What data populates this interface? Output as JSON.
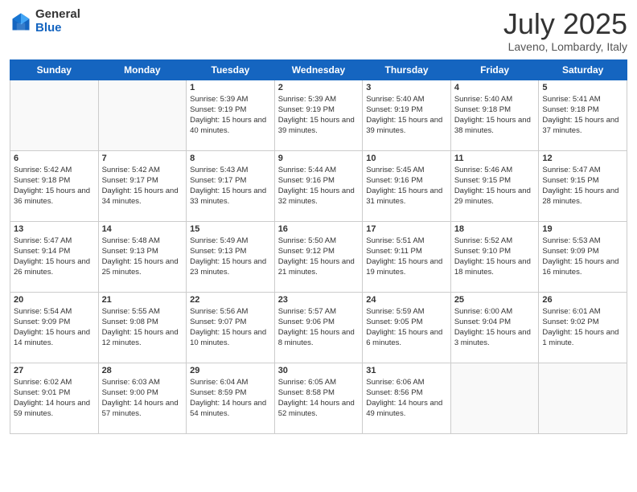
{
  "header": {
    "logo_general": "General",
    "logo_blue": "Blue",
    "month_title": "July 2025",
    "location": "Laveno, Lombardy, Italy"
  },
  "weekdays": [
    "Sunday",
    "Monday",
    "Tuesday",
    "Wednesday",
    "Thursday",
    "Friday",
    "Saturday"
  ],
  "weeks": [
    [
      {
        "day": "",
        "sunrise": "",
        "sunset": "",
        "daylight": ""
      },
      {
        "day": "",
        "sunrise": "",
        "sunset": "",
        "daylight": ""
      },
      {
        "day": "1",
        "sunrise": "Sunrise: 5:39 AM",
        "sunset": "Sunset: 9:19 PM",
        "daylight": "Daylight: 15 hours and 40 minutes."
      },
      {
        "day": "2",
        "sunrise": "Sunrise: 5:39 AM",
        "sunset": "Sunset: 9:19 PM",
        "daylight": "Daylight: 15 hours and 39 minutes."
      },
      {
        "day": "3",
        "sunrise": "Sunrise: 5:40 AM",
        "sunset": "Sunset: 9:19 PM",
        "daylight": "Daylight: 15 hours and 39 minutes."
      },
      {
        "day": "4",
        "sunrise": "Sunrise: 5:40 AM",
        "sunset": "Sunset: 9:18 PM",
        "daylight": "Daylight: 15 hours and 38 minutes."
      },
      {
        "day": "5",
        "sunrise": "Sunrise: 5:41 AM",
        "sunset": "Sunset: 9:18 PM",
        "daylight": "Daylight: 15 hours and 37 minutes."
      }
    ],
    [
      {
        "day": "6",
        "sunrise": "Sunrise: 5:42 AM",
        "sunset": "Sunset: 9:18 PM",
        "daylight": "Daylight: 15 hours and 36 minutes."
      },
      {
        "day": "7",
        "sunrise": "Sunrise: 5:42 AM",
        "sunset": "Sunset: 9:17 PM",
        "daylight": "Daylight: 15 hours and 34 minutes."
      },
      {
        "day": "8",
        "sunrise": "Sunrise: 5:43 AM",
        "sunset": "Sunset: 9:17 PM",
        "daylight": "Daylight: 15 hours and 33 minutes."
      },
      {
        "day": "9",
        "sunrise": "Sunrise: 5:44 AM",
        "sunset": "Sunset: 9:16 PM",
        "daylight": "Daylight: 15 hours and 32 minutes."
      },
      {
        "day": "10",
        "sunrise": "Sunrise: 5:45 AM",
        "sunset": "Sunset: 9:16 PM",
        "daylight": "Daylight: 15 hours and 31 minutes."
      },
      {
        "day": "11",
        "sunrise": "Sunrise: 5:46 AM",
        "sunset": "Sunset: 9:15 PM",
        "daylight": "Daylight: 15 hours and 29 minutes."
      },
      {
        "day": "12",
        "sunrise": "Sunrise: 5:47 AM",
        "sunset": "Sunset: 9:15 PM",
        "daylight": "Daylight: 15 hours and 28 minutes."
      }
    ],
    [
      {
        "day": "13",
        "sunrise": "Sunrise: 5:47 AM",
        "sunset": "Sunset: 9:14 PM",
        "daylight": "Daylight: 15 hours and 26 minutes."
      },
      {
        "day": "14",
        "sunrise": "Sunrise: 5:48 AM",
        "sunset": "Sunset: 9:13 PM",
        "daylight": "Daylight: 15 hours and 25 minutes."
      },
      {
        "day": "15",
        "sunrise": "Sunrise: 5:49 AM",
        "sunset": "Sunset: 9:13 PM",
        "daylight": "Daylight: 15 hours and 23 minutes."
      },
      {
        "day": "16",
        "sunrise": "Sunrise: 5:50 AM",
        "sunset": "Sunset: 9:12 PM",
        "daylight": "Daylight: 15 hours and 21 minutes."
      },
      {
        "day": "17",
        "sunrise": "Sunrise: 5:51 AM",
        "sunset": "Sunset: 9:11 PM",
        "daylight": "Daylight: 15 hours and 19 minutes."
      },
      {
        "day": "18",
        "sunrise": "Sunrise: 5:52 AM",
        "sunset": "Sunset: 9:10 PM",
        "daylight": "Daylight: 15 hours and 18 minutes."
      },
      {
        "day": "19",
        "sunrise": "Sunrise: 5:53 AM",
        "sunset": "Sunset: 9:09 PM",
        "daylight": "Daylight: 15 hours and 16 minutes."
      }
    ],
    [
      {
        "day": "20",
        "sunrise": "Sunrise: 5:54 AM",
        "sunset": "Sunset: 9:09 PM",
        "daylight": "Daylight: 15 hours and 14 minutes."
      },
      {
        "day": "21",
        "sunrise": "Sunrise: 5:55 AM",
        "sunset": "Sunset: 9:08 PM",
        "daylight": "Daylight: 15 hours and 12 minutes."
      },
      {
        "day": "22",
        "sunrise": "Sunrise: 5:56 AM",
        "sunset": "Sunset: 9:07 PM",
        "daylight": "Daylight: 15 hours and 10 minutes."
      },
      {
        "day": "23",
        "sunrise": "Sunrise: 5:57 AM",
        "sunset": "Sunset: 9:06 PM",
        "daylight": "Daylight: 15 hours and 8 minutes."
      },
      {
        "day": "24",
        "sunrise": "Sunrise: 5:59 AM",
        "sunset": "Sunset: 9:05 PM",
        "daylight": "Daylight: 15 hours and 6 minutes."
      },
      {
        "day": "25",
        "sunrise": "Sunrise: 6:00 AM",
        "sunset": "Sunset: 9:04 PM",
        "daylight": "Daylight: 15 hours and 3 minutes."
      },
      {
        "day": "26",
        "sunrise": "Sunrise: 6:01 AM",
        "sunset": "Sunset: 9:02 PM",
        "daylight": "Daylight: 15 hours and 1 minute."
      }
    ],
    [
      {
        "day": "27",
        "sunrise": "Sunrise: 6:02 AM",
        "sunset": "Sunset: 9:01 PM",
        "daylight": "Daylight: 14 hours and 59 minutes."
      },
      {
        "day": "28",
        "sunrise": "Sunrise: 6:03 AM",
        "sunset": "Sunset: 9:00 PM",
        "daylight": "Daylight: 14 hours and 57 minutes."
      },
      {
        "day": "29",
        "sunrise": "Sunrise: 6:04 AM",
        "sunset": "Sunset: 8:59 PM",
        "daylight": "Daylight: 14 hours and 54 minutes."
      },
      {
        "day": "30",
        "sunrise": "Sunrise: 6:05 AM",
        "sunset": "Sunset: 8:58 PM",
        "daylight": "Daylight: 14 hours and 52 minutes."
      },
      {
        "day": "31",
        "sunrise": "Sunrise: 6:06 AM",
        "sunset": "Sunset: 8:56 PM",
        "daylight": "Daylight: 14 hours and 49 minutes."
      },
      {
        "day": "",
        "sunrise": "",
        "sunset": "",
        "daylight": ""
      },
      {
        "day": "",
        "sunrise": "",
        "sunset": "",
        "daylight": ""
      }
    ]
  ]
}
